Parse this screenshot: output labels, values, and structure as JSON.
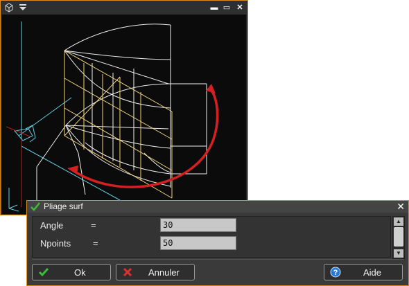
{
  "viewport": {
    "title_icons": [
      "cube-icon",
      "dropdown-arrow-icon"
    ],
    "controls": {
      "minimize": "▬",
      "maximize": "▭",
      "close": "✕"
    }
  },
  "dialog": {
    "title": "Pliage surf",
    "close": "✕",
    "params": [
      {
        "label": "Angle",
        "eq": "=",
        "value": "30"
      },
      {
        "label": "Npoints",
        "eq": "=",
        "value": "50"
      }
    ],
    "buttons": {
      "ok": "Ok",
      "cancel": "Annuler",
      "help": "Aide"
    }
  },
  "colors": {
    "accent_border": "#e08a1e",
    "ok_check": "#3bbf3b",
    "cancel_x": "#e03030",
    "help": "#2a7bd6",
    "fold_arrow": "#d42020",
    "surface_yellow": "#f2d27a",
    "axis_cyan": "#5fd0e0"
  }
}
